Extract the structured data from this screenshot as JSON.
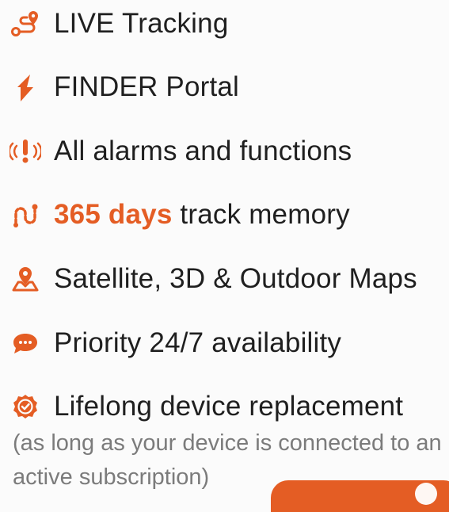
{
  "accent_color": "#e45d24",
  "features": [
    {
      "icon": "route-pin-icon",
      "text": "LIVE Tracking"
    },
    {
      "icon": "portal-logo-icon",
      "text": "FINDER Portal"
    },
    {
      "icon": "alarm-icon",
      "text": "All alarms and functions"
    },
    {
      "icon": "track-memory-icon",
      "highlight": "365 days",
      "text": " track memory"
    },
    {
      "icon": "map-pin-icon",
      "text": "Satellite, 3D & Outdoor Maps"
    },
    {
      "icon": "support-chat-icon",
      "text": "Priority 24/7 availability"
    },
    {
      "icon": "badge-check-icon",
      "text": "Lifelong device replacement"
    }
  ],
  "note": "(as long as your device is connected to an active subscription)"
}
